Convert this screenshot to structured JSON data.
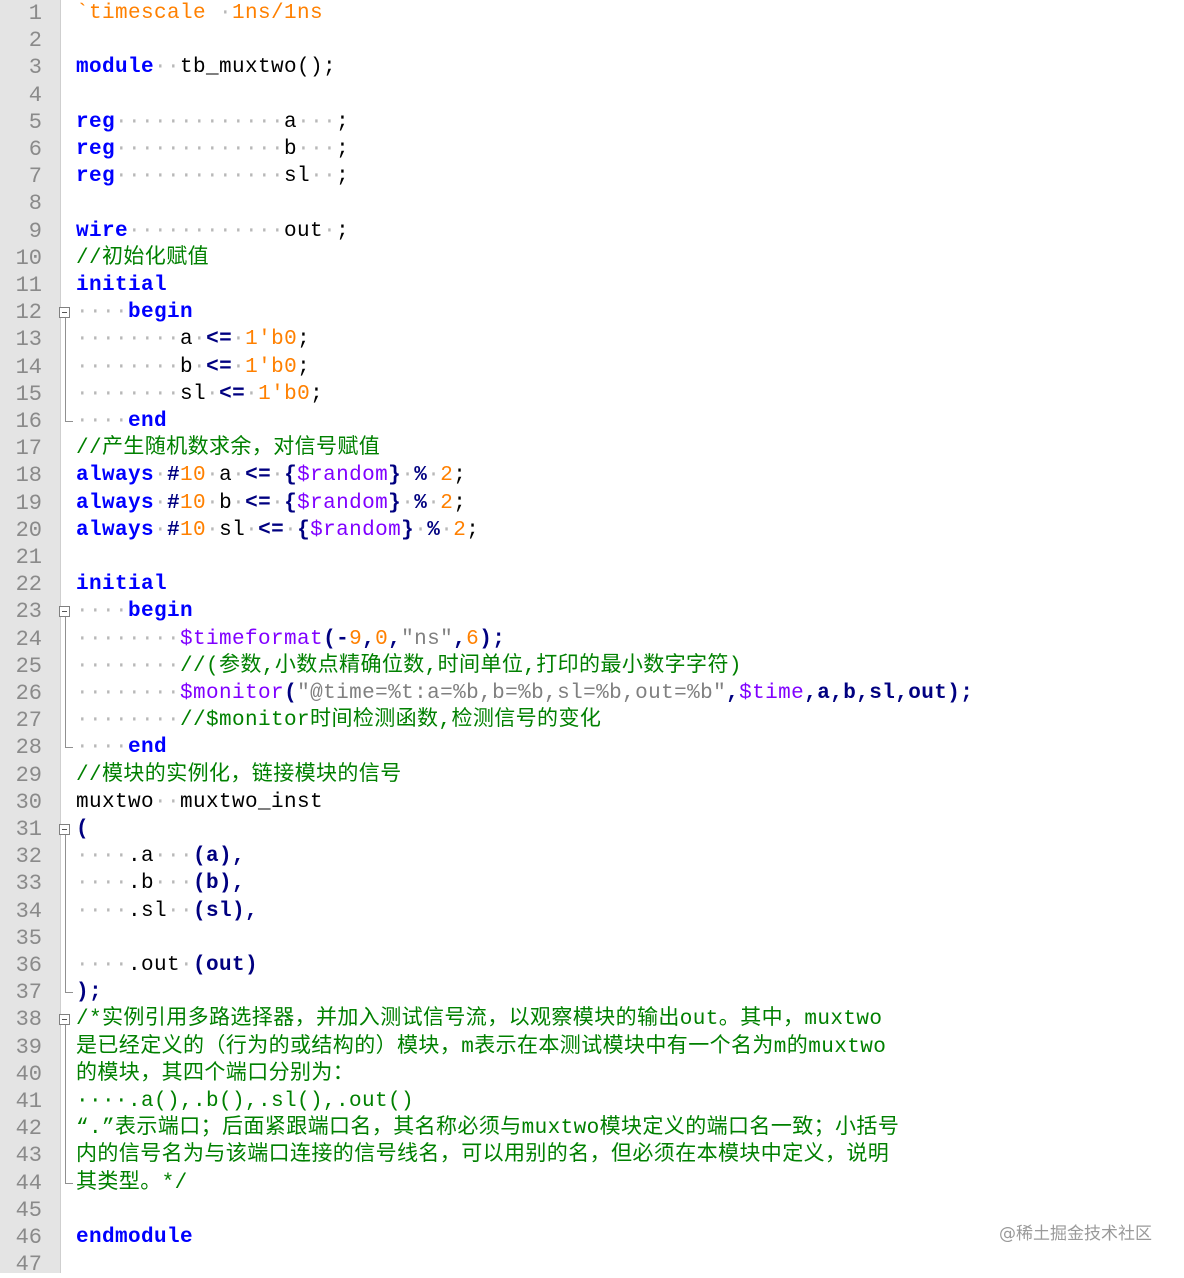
{
  "editor": {
    "lines": [
      {
        "n": "1",
        "segs": [
          {
            "t": "`timescale ",
            "c": "num"
          },
          {
            "t": "·",
            "c": "ws"
          },
          {
            "t": "1ns/1ns",
            "c": "num"
          }
        ]
      },
      {
        "n": "2",
        "segs": []
      },
      {
        "n": "3",
        "segs": [
          {
            "t": "module",
            "c": "kw"
          },
          {
            "t": "··",
            "c": "ws"
          },
          {
            "t": "tb_muxtwo();",
            "c": ""
          }
        ]
      },
      {
        "n": "4",
        "segs": []
      },
      {
        "n": "5",
        "segs": [
          {
            "t": "reg",
            "c": "kw"
          },
          {
            "t": "·············",
            "c": "ws"
          },
          {
            "t": "a",
            "c": ""
          },
          {
            "t": "···",
            "c": "ws"
          },
          {
            "t": ";",
            "c": ""
          }
        ]
      },
      {
        "n": "6",
        "segs": [
          {
            "t": "reg",
            "c": "kw"
          },
          {
            "t": "·············",
            "c": "ws"
          },
          {
            "t": "b",
            "c": ""
          },
          {
            "t": "···",
            "c": "ws"
          },
          {
            "t": ";",
            "c": ""
          }
        ]
      },
      {
        "n": "7",
        "segs": [
          {
            "t": "reg",
            "c": "kw"
          },
          {
            "t": "·············",
            "c": "ws"
          },
          {
            "t": "sl",
            "c": ""
          },
          {
            "t": "··",
            "c": "ws"
          },
          {
            "t": ";",
            "c": ""
          }
        ]
      },
      {
        "n": "8",
        "segs": []
      },
      {
        "n": "9",
        "segs": [
          {
            "t": "wire",
            "c": "kw"
          },
          {
            "t": "············",
            "c": "ws"
          },
          {
            "t": "out",
            "c": ""
          },
          {
            "t": "·",
            "c": "ws"
          },
          {
            "t": ";",
            "c": ""
          }
        ]
      },
      {
        "n": "10",
        "segs": [
          {
            "t": "//初始化赋值",
            "c": "cm"
          }
        ]
      },
      {
        "n": "11",
        "segs": [
          {
            "t": "initial",
            "c": "kw"
          }
        ]
      },
      {
        "n": "12",
        "segs": [
          {
            "t": "····",
            "c": "ws"
          },
          {
            "t": "begin",
            "c": "kw"
          }
        ]
      },
      {
        "n": "13",
        "segs": [
          {
            "t": "········",
            "c": "ws"
          },
          {
            "t": "a",
            "c": ""
          },
          {
            "t": "·",
            "c": "ws"
          },
          {
            "t": "<=",
            "c": "op"
          },
          {
            "t": "·",
            "c": "ws"
          },
          {
            "t": "1'b0",
            "c": "num"
          },
          {
            "t": ";",
            "c": ""
          }
        ]
      },
      {
        "n": "14",
        "segs": [
          {
            "t": "········",
            "c": "ws"
          },
          {
            "t": "b",
            "c": ""
          },
          {
            "t": "·",
            "c": "ws"
          },
          {
            "t": "<=",
            "c": "op"
          },
          {
            "t": "·",
            "c": "ws"
          },
          {
            "t": "1'b0",
            "c": "num"
          },
          {
            "t": ";",
            "c": ""
          }
        ]
      },
      {
        "n": "15",
        "segs": [
          {
            "t": "········",
            "c": "ws"
          },
          {
            "t": "sl",
            "c": ""
          },
          {
            "t": "·",
            "c": "ws"
          },
          {
            "t": "<=",
            "c": "op"
          },
          {
            "t": "·",
            "c": "ws"
          },
          {
            "t": "1'b0",
            "c": "num"
          },
          {
            "t": ";",
            "c": ""
          }
        ]
      },
      {
        "n": "16",
        "segs": [
          {
            "t": "····",
            "c": "ws"
          },
          {
            "t": "end",
            "c": "kw"
          }
        ]
      },
      {
        "n": "17",
        "segs": [
          {
            "t": "//产生随机数求余，对信号赋值",
            "c": "cm"
          }
        ]
      },
      {
        "n": "18",
        "segs": [
          {
            "t": "always",
            "c": "kw"
          },
          {
            "t": "·",
            "c": "ws"
          },
          {
            "t": "#",
            "c": "op"
          },
          {
            "t": "10",
            "c": "num"
          },
          {
            "t": "·",
            "c": "ws"
          },
          {
            "t": "a",
            "c": ""
          },
          {
            "t": "·",
            "c": "ws"
          },
          {
            "t": "<=",
            "c": "op"
          },
          {
            "t": "·",
            "c": "ws"
          },
          {
            "t": "{",
            "c": "op"
          },
          {
            "t": "$random",
            "c": "sys"
          },
          {
            "t": "}",
            "c": "op"
          },
          {
            "t": "·",
            "c": "ws"
          },
          {
            "t": "%",
            "c": "op"
          },
          {
            "t": "·",
            "c": "ws"
          },
          {
            "t": "2",
            "c": "num"
          },
          {
            "t": ";",
            "c": ""
          }
        ]
      },
      {
        "n": "19",
        "segs": [
          {
            "t": "always",
            "c": "kw"
          },
          {
            "t": "·",
            "c": "ws"
          },
          {
            "t": "#",
            "c": "op"
          },
          {
            "t": "10",
            "c": "num"
          },
          {
            "t": "·",
            "c": "ws"
          },
          {
            "t": "b",
            "c": ""
          },
          {
            "t": "·",
            "c": "ws"
          },
          {
            "t": "<=",
            "c": "op"
          },
          {
            "t": "·",
            "c": "ws"
          },
          {
            "t": "{",
            "c": "op"
          },
          {
            "t": "$random",
            "c": "sys"
          },
          {
            "t": "}",
            "c": "op"
          },
          {
            "t": "·",
            "c": "ws"
          },
          {
            "t": "%",
            "c": "op"
          },
          {
            "t": "·",
            "c": "ws"
          },
          {
            "t": "2",
            "c": "num"
          },
          {
            "t": ";",
            "c": ""
          }
        ]
      },
      {
        "n": "20",
        "segs": [
          {
            "t": "always",
            "c": "kw"
          },
          {
            "t": "·",
            "c": "ws"
          },
          {
            "t": "#",
            "c": "op"
          },
          {
            "t": "10",
            "c": "num"
          },
          {
            "t": "·",
            "c": "ws"
          },
          {
            "t": "sl",
            "c": ""
          },
          {
            "t": "·",
            "c": "ws"
          },
          {
            "t": "<=",
            "c": "op"
          },
          {
            "t": "·",
            "c": "ws"
          },
          {
            "t": "{",
            "c": "op"
          },
          {
            "t": "$random",
            "c": "sys"
          },
          {
            "t": "}",
            "c": "op"
          },
          {
            "t": "·",
            "c": "ws"
          },
          {
            "t": "%",
            "c": "op"
          },
          {
            "t": "·",
            "c": "ws"
          },
          {
            "t": "2",
            "c": "num"
          },
          {
            "t": ";",
            "c": ""
          }
        ]
      },
      {
        "n": "21",
        "segs": []
      },
      {
        "n": "22",
        "segs": [
          {
            "t": "initial",
            "c": "kw"
          }
        ]
      },
      {
        "n": "23",
        "segs": [
          {
            "t": "····",
            "c": "ws"
          },
          {
            "t": "begin",
            "c": "kw"
          }
        ]
      },
      {
        "n": "24",
        "segs": [
          {
            "t": "········",
            "c": "ws"
          },
          {
            "t": "$timeformat",
            "c": "sys"
          },
          {
            "t": "(-",
            "c": "op"
          },
          {
            "t": "9",
            "c": "num"
          },
          {
            "t": ",",
            "c": "op"
          },
          {
            "t": "0",
            "c": "num"
          },
          {
            "t": ",",
            "c": "op"
          },
          {
            "t": "\"ns\"",
            "c": "str"
          },
          {
            "t": ",",
            "c": "op"
          },
          {
            "t": "6",
            "c": "num"
          },
          {
            "t": ");",
            "c": "op"
          }
        ]
      },
      {
        "n": "25",
        "segs": [
          {
            "t": "········",
            "c": "ws"
          },
          {
            "t": "//(参数,小数点精确位数,时间单位,打印的最小数字字符)",
            "c": "cm"
          }
        ]
      },
      {
        "n": "26",
        "segs": [
          {
            "t": "········",
            "c": "ws"
          },
          {
            "t": "$monitor",
            "c": "sys"
          },
          {
            "t": "(",
            "c": "op"
          },
          {
            "t": "\"@time=%t:a=%b,b=%b,sl=%b,out=%b\"",
            "c": "str"
          },
          {
            "t": ",",
            "c": "op"
          },
          {
            "t": "$time",
            "c": "sys"
          },
          {
            "t": ",a,b,sl,out);",
            "c": "op"
          }
        ]
      },
      {
        "n": "27",
        "segs": [
          {
            "t": "········",
            "c": "ws"
          },
          {
            "t": "//$monitor时间检测函数,检测信号的变化",
            "c": "cm"
          }
        ]
      },
      {
        "n": "28",
        "segs": [
          {
            "t": "····",
            "c": "ws"
          },
          {
            "t": "end",
            "c": "kw"
          }
        ]
      },
      {
        "n": "29",
        "segs": [
          {
            "t": "//模块的实例化，链接模块的信号",
            "c": "cm"
          }
        ]
      },
      {
        "n": "30",
        "segs": [
          {
            "t": "muxtwo",
            "c": ""
          },
          {
            "t": "··",
            "c": "ws"
          },
          {
            "t": "muxtwo_inst",
            "c": ""
          }
        ]
      },
      {
        "n": "31",
        "segs": [
          {
            "t": "(",
            "c": "op"
          }
        ]
      },
      {
        "n": "32",
        "segs": [
          {
            "t": "····",
            "c": "ws"
          },
          {
            "t": ".a",
            "c": ""
          },
          {
            "t": "···",
            "c": "ws"
          },
          {
            "t": "(a),",
            "c": "op"
          }
        ]
      },
      {
        "n": "33",
        "segs": [
          {
            "t": "····",
            "c": "ws"
          },
          {
            "t": ".b",
            "c": ""
          },
          {
            "t": "···",
            "c": "ws"
          },
          {
            "t": "(b),",
            "c": "op"
          }
        ]
      },
      {
        "n": "34",
        "segs": [
          {
            "t": "····",
            "c": "ws"
          },
          {
            "t": ".sl",
            "c": ""
          },
          {
            "t": "··",
            "c": "ws"
          },
          {
            "t": "(sl),",
            "c": "op"
          }
        ]
      },
      {
        "n": "35",
        "segs": []
      },
      {
        "n": "36",
        "segs": [
          {
            "t": "····",
            "c": "ws"
          },
          {
            "t": ".out",
            "c": ""
          },
          {
            "t": "·",
            "c": "ws"
          },
          {
            "t": "(out)",
            "c": "op"
          }
        ]
      },
      {
        "n": "37",
        "segs": [
          {
            "t": ");",
            "c": "op"
          }
        ]
      },
      {
        "n": "38",
        "segs": [
          {
            "t": "/*实例引用多路选择器，并加入测试信号流，以观察模块的输出out。其中，muxtwo",
            "c": "cm"
          }
        ]
      },
      {
        "n": "39",
        "segs": [
          {
            "t": "是已经定义的（行为的或结构的）模块，m表示在本测试模块中有一个名为m的muxtwo",
            "c": "cm"
          }
        ]
      },
      {
        "n": "40",
        "segs": [
          {
            "t": "的模块，其四个端口分别为：",
            "c": "cm"
          }
        ]
      },
      {
        "n": "41",
        "segs": [
          {
            "t": "····.a(),.b(),.sl(),.out()",
            "c": "cm"
          }
        ]
      },
      {
        "n": "42",
        "segs": [
          {
            "t": "“.”表示端口；后面紧跟端口名，其名称必须与muxtwo模块定义的端口名一致；小括号",
            "c": "cm"
          }
        ]
      },
      {
        "n": "43",
        "segs": [
          {
            "t": "内的信号名为与该端口连接的信号线名，可以用别的名，但必须在本模块中定义，说明",
            "c": "cm"
          }
        ]
      },
      {
        "n": "44",
        "segs": [
          {
            "t": "其类型。*/",
            "c": "cm"
          }
        ]
      },
      {
        "n": "45",
        "segs": []
      },
      {
        "n": "46",
        "segs": [
          {
            "t": "endmodule",
            "c": "kw"
          }
        ]
      },
      {
        "n": "47",
        "segs": []
      }
    ]
  },
  "watermark": "@稀土掘金技术社区"
}
